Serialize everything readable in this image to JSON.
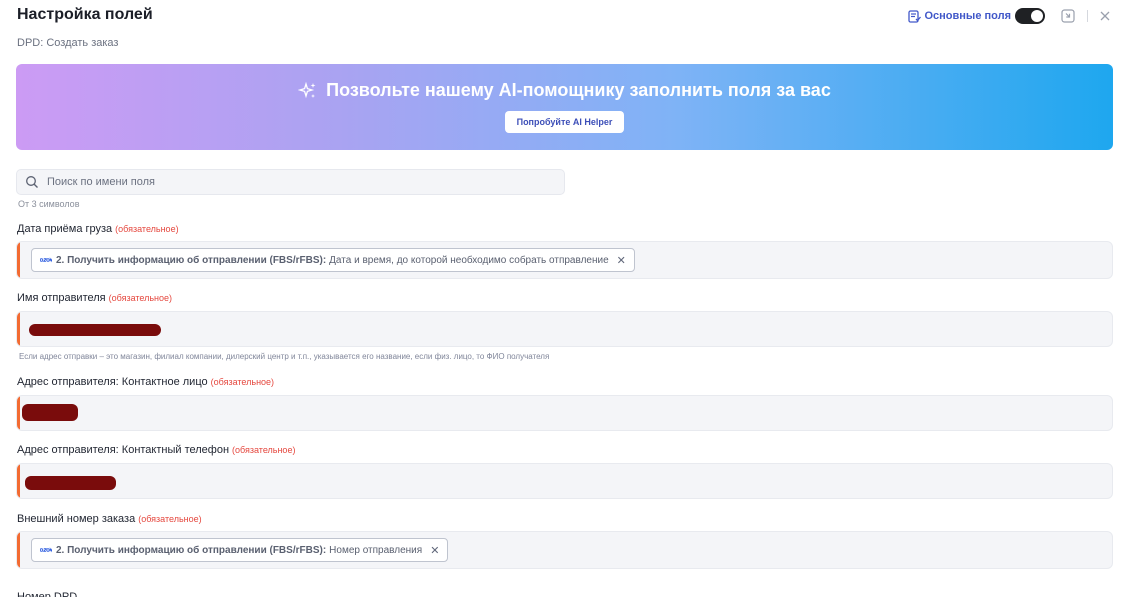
{
  "header": {
    "title": "Настройка полей",
    "subtitle": "DPD: Создать заказ",
    "main_fields_label": "Основные поля",
    "toggle_on": true
  },
  "ai_banner": {
    "headline": "Позвольте нашему AI-помощнику заполнить поля за вас",
    "button_label": "Попробуйте AI Helper"
  },
  "search": {
    "placeholder": "Поиск по имени поля",
    "hint": "От 3 символов"
  },
  "fields": [
    {
      "label": "Дата приёма груза",
      "required_tag": "(обязательное)",
      "chip_app": "2. Получить информацию об отправлении (FBS/rFBS):",
      "chip_value": "Дата и время, до которой необходимо собрать отправление"
    },
    {
      "label": "Имя отправителя",
      "required_tag": "(обязательное)",
      "help": "Если адрес отправки – это магазин, филиал компании, дилерский центр и т.п., указывается его название, если физ. лицо, то ФИО получателя"
    },
    {
      "label": "Адрес отправителя: Контактное лицо",
      "required_tag": "(обязательное)"
    },
    {
      "label": "Адрес отправителя: Контактный телефон",
      "required_tag": "(обязательное)"
    },
    {
      "label": "Внешний номер заказа",
      "required_tag": "(обязательное)",
      "chip_app": "2. Получить информацию об отправлении (FBS/rFBS):",
      "chip_value": "Номер отправления"
    },
    {
      "label": "Номер DPD"
    }
  ],
  "colors": {
    "accent": "#4158c9",
    "required": "#e5483f",
    "field_marker": "#f36b32",
    "redacted": "#7a0c0c"
  }
}
